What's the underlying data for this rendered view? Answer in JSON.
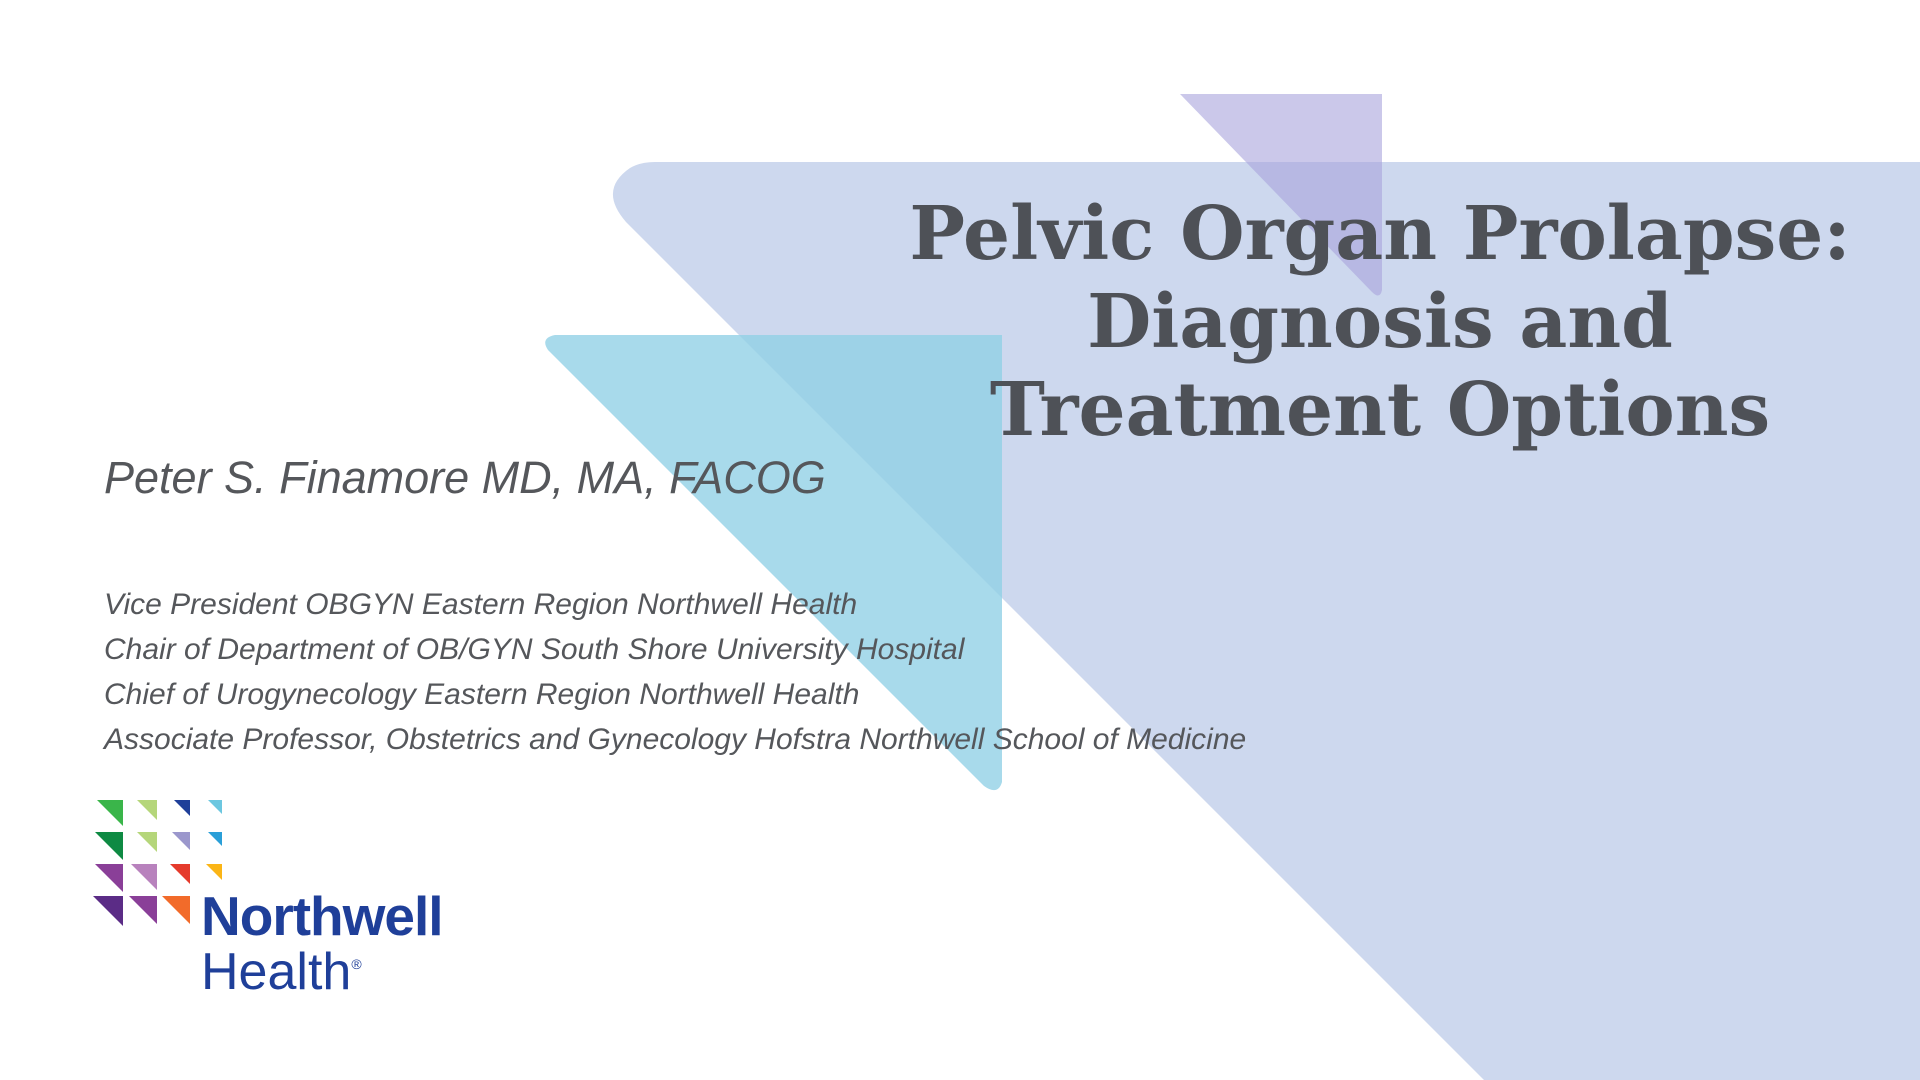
{
  "title": {
    "lines": [
      "Pelvic Organ Prolapse:",
      "Diagnosis and",
      "Treatment Options"
    ]
  },
  "presenter": {
    "name": "Peter S. Finamore MD, MA, FACOG",
    "affiliations": [
      "Vice President OBGYN Eastern Region Northwell Health",
      "Chair of Department of OB/GYN South Shore University Hospital",
      "Chief of Urogynecology Eastern Region Northwell Health",
      "Associate Professor, Obstetrics and Gynecology Hofstra Northwell School of Medicine"
    ]
  },
  "logo": {
    "word1": "Northwell",
    "word2": "Health",
    "registered": "®",
    "colors": [
      "#3ab54a",
      "#b5d67a",
      "#1f3f99",
      "#6cc7e0",
      "#0e8a43",
      "#b5d67a",
      "#9b97cc",
      "#2a9fd8",
      "#8a3f98",
      "#b882bd",
      "#e53b2c",
      "#fbb516",
      "#5b2c86",
      "#8a3f98",
      "#f26b2a"
    ]
  },
  "colors": {
    "lavender_shape": "#cdd8ee",
    "purple_triangle": "#a9a3dc",
    "cyan_triangle": "#8fd0e6",
    "text": "#55575b",
    "title": "#4e5157",
    "brand": "#1f3f99"
  }
}
